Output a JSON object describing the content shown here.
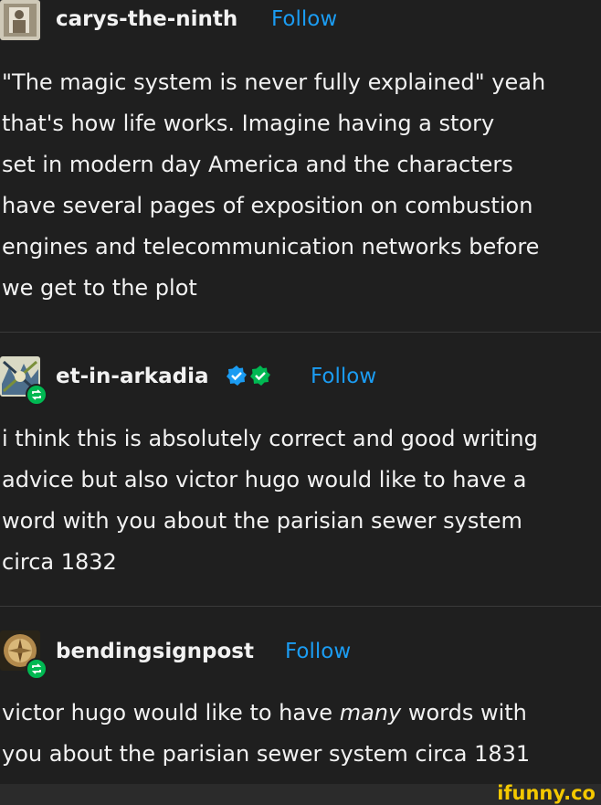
{
  "posts": [
    {
      "username": "carys-the-ninth",
      "follow_label": "Follow",
      "lines": [
        "\"The magic system is never fully explained\" yeah",
        "that's how life works. Imagine having a story",
        "set in modern day America and the characters",
        "have several pages of exposition on combustion",
        "engines and telecommunication networks before",
        "we get to the plot"
      ]
    },
    {
      "username": "et-in-arkadia",
      "follow_label": "Follow",
      "lines": [
        "i think this is absolutely correct and good writing",
        "advice but also victor hugo would like to have a",
        "word with you about the parisian sewer system",
        "circa 1832"
      ]
    },
    {
      "username": "bendingsignpost",
      "follow_label": "Follow",
      "line1_before": "victor hugo would like to have ",
      "line1_emphasis": "many",
      "line1_after": " words with",
      "line2": "you about the parisian sewer system circa 1831"
    }
  ],
  "watermark": "ifunny.co",
  "colors": {
    "background": "#1f1f1f",
    "follow": "#1b9cf2",
    "reblog": "#00b852",
    "verified_blue": "#1b9cf2",
    "verified_green": "#00b852",
    "watermark": "#f3c800"
  },
  "icons": [
    "reblog-icon",
    "verified-blue-badge-icon",
    "verified-green-badge-icon"
  ]
}
